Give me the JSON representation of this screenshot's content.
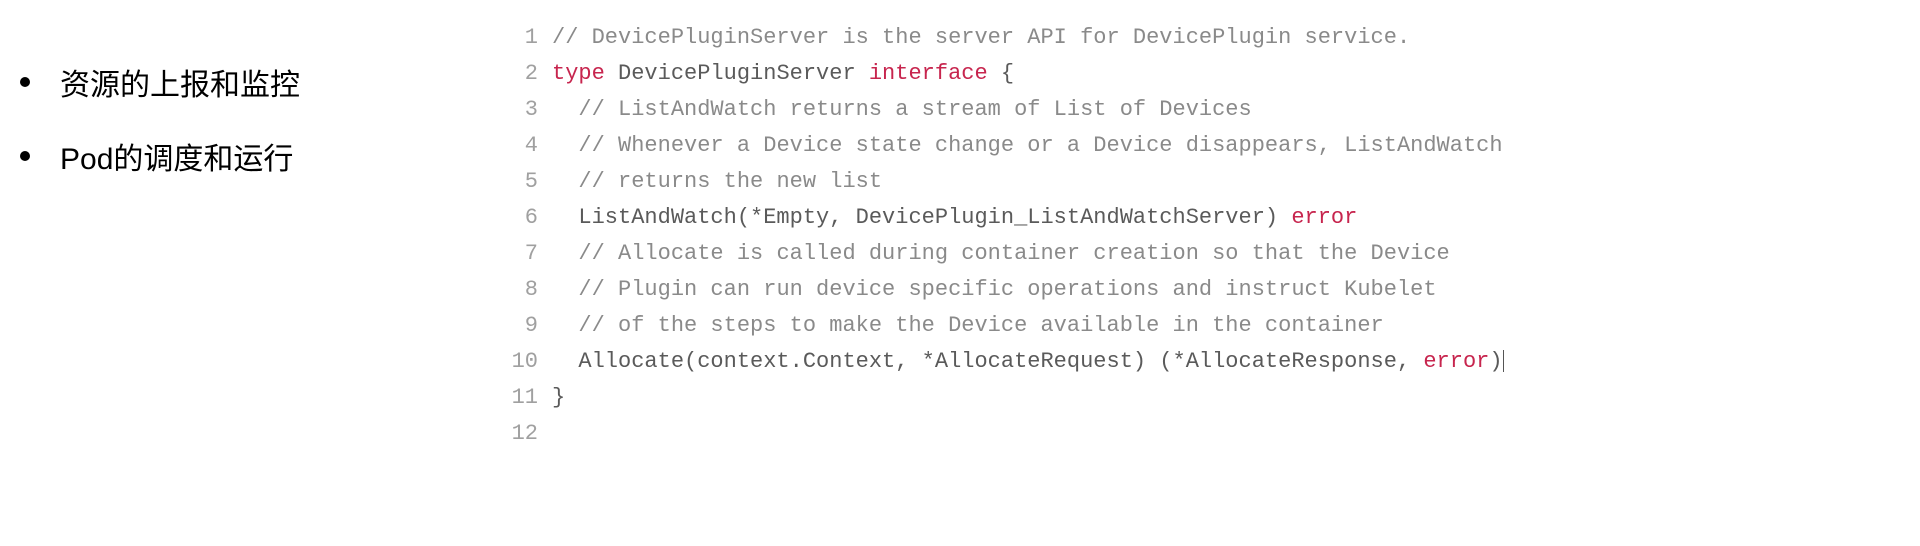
{
  "bullets": [
    "资源的上报和监控",
    "Pod的调度和运行"
  ],
  "code": {
    "lines": [
      {
        "n": "1",
        "tokens": [
          {
            "t": "// DevicePluginServer is the server API for DevicePlugin service.",
            "c": "comment"
          }
        ]
      },
      {
        "n": "2",
        "tokens": [
          {
            "t": "type",
            "c": "kw"
          },
          {
            "t": " DevicePluginServer ",
            "c": ""
          },
          {
            "t": "interface",
            "c": "kw"
          },
          {
            "t": " {",
            "c": ""
          }
        ]
      },
      {
        "n": "3",
        "tokens": [
          {
            "t": "  ",
            "c": ""
          },
          {
            "t": "// ListAndWatch returns a stream of List of Devices",
            "c": "comment"
          }
        ]
      },
      {
        "n": "4",
        "tokens": [
          {
            "t": "  ",
            "c": ""
          },
          {
            "t": "// Whenever a Device state change or a Device disappears, ListAndWatch",
            "c": "comment"
          }
        ]
      },
      {
        "n": "5",
        "tokens": [
          {
            "t": "  ",
            "c": ""
          },
          {
            "t": "// returns the new list",
            "c": "comment"
          }
        ]
      },
      {
        "n": "6",
        "tokens": [
          {
            "t": "  ListAndWatch(*Empty, DevicePlugin_ListAndWatchServer) ",
            "c": ""
          },
          {
            "t": "error",
            "c": "kw"
          }
        ]
      },
      {
        "n": "7",
        "tokens": [
          {
            "t": "  ",
            "c": ""
          },
          {
            "t": "// Allocate is called during container creation so that the Device",
            "c": "comment"
          }
        ]
      },
      {
        "n": "8",
        "tokens": [
          {
            "t": "  ",
            "c": ""
          },
          {
            "t": "// Plugin can run device specific operations and instruct Kubelet",
            "c": "comment"
          }
        ]
      },
      {
        "n": "9",
        "tokens": [
          {
            "t": "  ",
            "c": ""
          },
          {
            "t": "// of the steps to make the Device available in the container",
            "c": "comment"
          }
        ]
      },
      {
        "n": "10",
        "tokens": [
          {
            "t": "  Allocate(context.Context, *AllocateRequest) (*AllocateResponse, ",
            "c": ""
          },
          {
            "t": "error",
            "c": "kw"
          },
          {
            "t": ")",
            "c": ""
          }
        ],
        "cursor": true
      },
      {
        "n": "11",
        "tokens": [
          {
            "t": "}",
            "c": ""
          }
        ]
      },
      {
        "n": "12",
        "tokens": [
          {
            "t": "",
            "c": ""
          }
        ]
      }
    ]
  }
}
